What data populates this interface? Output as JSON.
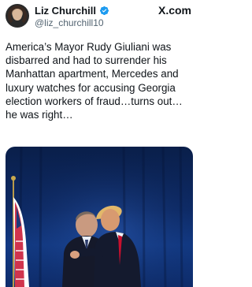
{
  "author": {
    "name": "Liz Churchill",
    "handle": "@liz_churchill10",
    "verified_color": "#1d9bf0"
  },
  "platform": {
    "logo_text": "X.com"
  },
  "tweet": {
    "text": "America’s Mayor Rudy Giuliani was disbarred and had to surrender his Manhattan apartment, Mercedes and luxury watches for accusing Georgia election workers of fraud…turns out… he was right…"
  },
  "colors": {
    "text": "#0f1419",
    "secondary": "#536471",
    "photo_background": "#0d2a66",
    "flag_red": "#c8102e"
  },
  "icons": [
    "avatar",
    "verified-badge-icon",
    "x-logo-icon"
  ]
}
